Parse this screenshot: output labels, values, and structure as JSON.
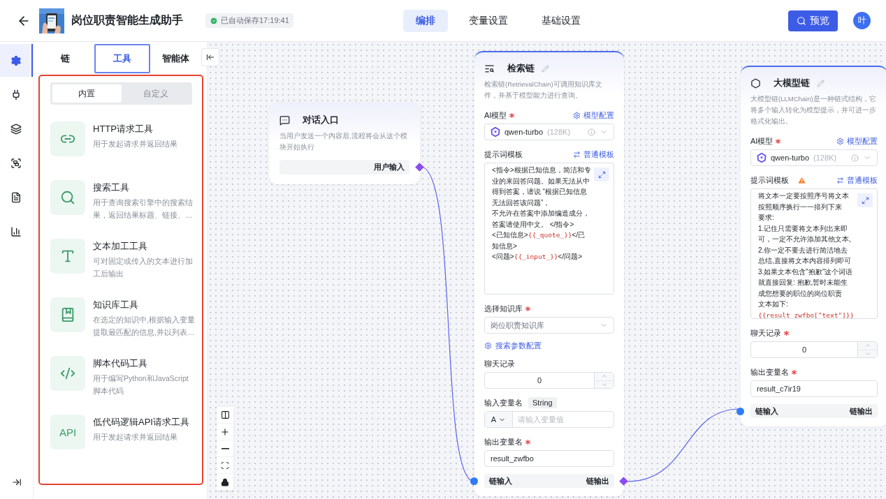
{
  "header": {
    "title": "岗位职责智能生成助手",
    "save_status": "已自动保存17:19:41",
    "tabs": [
      {
        "label": "编排",
        "selected": true
      },
      {
        "label": "变量设置",
        "selected": false
      },
      {
        "label": "基础设置",
        "selected": false
      }
    ],
    "preview": "预览",
    "avatar": "叶"
  },
  "rail": [
    {
      "selected": true
    },
    {
      "selected": false
    },
    {
      "selected": false
    },
    {
      "selected": false
    },
    {
      "selected": false
    },
    {
      "selected": false
    }
  ],
  "panel": {
    "tabs": [
      {
        "label": "链",
        "selected": false
      },
      {
        "label": "工具",
        "selected": true
      },
      {
        "label": "智能体",
        "selected": false
      }
    ],
    "segments": [
      {
        "label": "内置",
        "selected": true
      },
      {
        "label": "自定义",
        "selected": false
      }
    ],
    "tools": [
      {
        "kind": "http",
        "title": "HTTP请求工具",
        "description": "用于发起请求并返回结果"
      },
      {
        "kind": "search",
        "title": "搜索工具",
        "description": "用于查询搜索引擎中的搜索结果，返回结果标题、链接、…"
      },
      {
        "kind": "text",
        "title": "文本加工工具",
        "description": "可对固定或传入的文本进行加工后输出"
      },
      {
        "kind": "knowledge",
        "title": "知识库工具",
        "description": "在选定的知识中,根据输入变量提取最匹配的信息,并以列表…"
      },
      {
        "kind": "code",
        "title": "脚本代码工具",
        "description": "用于编写Python和JavaScript脚本代码"
      },
      {
        "kind": "api",
        "title": "低代码逻辑API请求工具",
        "description": "用于发起请求并返回结果",
        "icon_text": "API"
      }
    ]
  },
  "nodes": [
    {
      "kind": "entry",
      "title": "对话入口",
      "description": "当用户发送一个内容后,流程将会从这个模块开始执行",
      "output": "用户输入"
    },
    {
      "kind": "retrieval",
      "title": "检索链",
      "description": "检索链(RetrievalChain)可调用知识库文件，并基于模型能力进行查询。",
      "fields": [
        {
          "kind": "model",
          "label": "AI模型",
          "required": true,
          "action": "模型配置",
          "model": "qwen-turbo",
          "context": "(128K)"
        },
        {
          "kind": "prompt",
          "label": "提示词模板",
          "warning": false,
          "action": "普通模板",
          "lines": [
            [
              {
                "text": "<指令>根据已知信息，简洁和专业的来回答问题。如果无法从中得到答案，请说 “根据已知信息无法回答该问题”，",
                "variable": false
              }
            ],
            [
              {
                "text": "不允许在答案中添加编造成分，答案请使用中文。 </指令>",
                "variable": false
              }
            ],
            [
              {
                "text": "<已知信息>",
                "variable": false
              },
              {
                "text": "{{_quote_}}",
                "variable": true
              },
              {
                "text": "</已知信息>",
                "variable": false
              }
            ],
            [
              {
                "text": "<问题>",
                "variable": false
              },
              {
                "text": "{{_input_}}",
                "variable": true
              },
              {
                "text": "</问题>",
                "variable": false
              }
            ]
          ]
        },
        {
          "kind": "select",
          "label": "选择知识库",
          "required": true,
          "value": "岗位职责知识库"
        },
        {
          "kind": "link",
          "label": "搜索参数配置"
        },
        {
          "kind": "number",
          "label": "聊天记录",
          "required": false,
          "value": "0"
        },
        {
          "kind": "variable",
          "label": "输入变量名",
          "type": "String",
          "prefix": "A",
          "placeholder": "请输入变量值"
        },
        {
          "kind": "text",
          "label": "输出变量名",
          "required": true,
          "value": "result_zwfbo"
        }
      ],
      "ports": {
        "input": "链输入",
        "output": "链输出"
      }
    },
    {
      "kind": "llm",
      "title": "大模型链",
      "description": "大模型链(LLMChain)是一种链式结构，它将多个输入转化为模型提示，并可进一步格式化输出。",
      "fields": [
        {
          "kind": "model",
          "label": "AI模型",
          "required": true,
          "action": "模型配置",
          "model": "qwen-turbo",
          "context": "(128K)"
        },
        {
          "kind": "prompt",
          "label": "提示词模板",
          "warning": true,
          "action": "普通模板",
          "lines": [
            [
              {
                "text": "将文本一定要按照序号将文本按照顺序换行一一排列下来",
                "variable": false
              }
            ],
            [
              {
                "text": "要求:",
                "variable": false
              }
            ],
            [
              {
                "text": "1.记住只需要将文本列出来即可，一定不允许添加其他文本,",
                "variable": false
              }
            ],
            [
              {
                "text": "2.你一定不要去进行简洁地去总结,直接将文本内容排列即可",
                "variable": false
              }
            ],
            [
              {
                "text": "3.如果文本包含\"抱歉\"这个词语就直接回复: 抱歉,暂时未能生成您想要的职位的岗位职责",
                "variable": false
              }
            ],
            [
              {
                "text": "文本如下:",
                "variable": false
              }
            ],
            [
              {
                "text": "{{result_zwfbo[\"text\"]}}",
                "variable": true
              }
            ]
          ]
        },
        {
          "kind": "number",
          "label": "聊天记录",
          "required": true,
          "value": "0"
        },
        {
          "kind": "text",
          "label": "输出变量名",
          "required": true,
          "value": "result_c7ir19"
        }
      ],
      "ports": {
        "input": "链输入",
        "output": "链输出"
      }
    }
  ]
}
